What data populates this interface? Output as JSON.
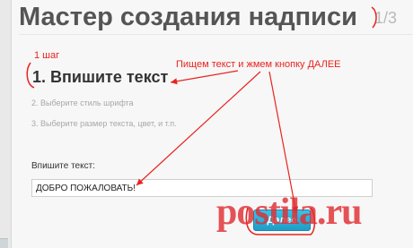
{
  "wizard": {
    "title": "Мастер создания надписи",
    "progress": "1/3"
  },
  "steps": [
    {
      "number": "1.",
      "label": "Впишите текст"
    },
    {
      "label": "2. Выберите стиль шрифта"
    },
    {
      "label": "3. Выберите размер текста, цвет, и т.п."
    }
  ],
  "form": {
    "field_label": "Впишите текст:",
    "field_value": "ДОБРО ПОЖАЛОВАТЬ!",
    "next_button_label": "Далее"
  },
  "annotations": {
    "step_note": "1 шаг",
    "instruction_note": "Пищем текст и жмем кнопку ДАЛЕЕ",
    "color": "#e8241f"
  },
  "watermark": {
    "text": "postila.ru"
  },
  "colors": {
    "button": "#1f9cc7",
    "title": "#555555"
  }
}
